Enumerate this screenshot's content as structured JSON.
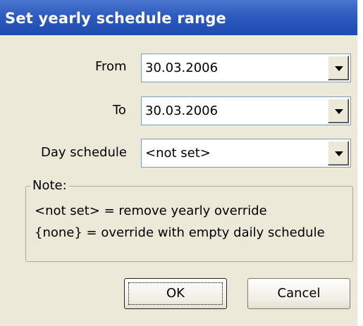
{
  "dialog": {
    "title": "Set yearly schedule range",
    "from": {
      "label": "From",
      "value": "30.03.2006"
    },
    "to": {
      "label": "To",
      "value": "30.03.2006"
    },
    "day_schedule": {
      "label": "Day schedule",
      "value": "<not set>"
    },
    "note": {
      "legend": "Note:",
      "line1": "<not set> = remove yearly override",
      "line2": "{none} = override with empty daily schedule"
    },
    "buttons": {
      "ok": "OK",
      "cancel": "Cancel"
    }
  },
  "icons": {
    "dropdown": "chevron-down-icon"
  },
  "colors": {
    "titlebar": "#2d5bbf",
    "dialog_bg": "#ece9d8",
    "field_border": "#7f9db9"
  }
}
